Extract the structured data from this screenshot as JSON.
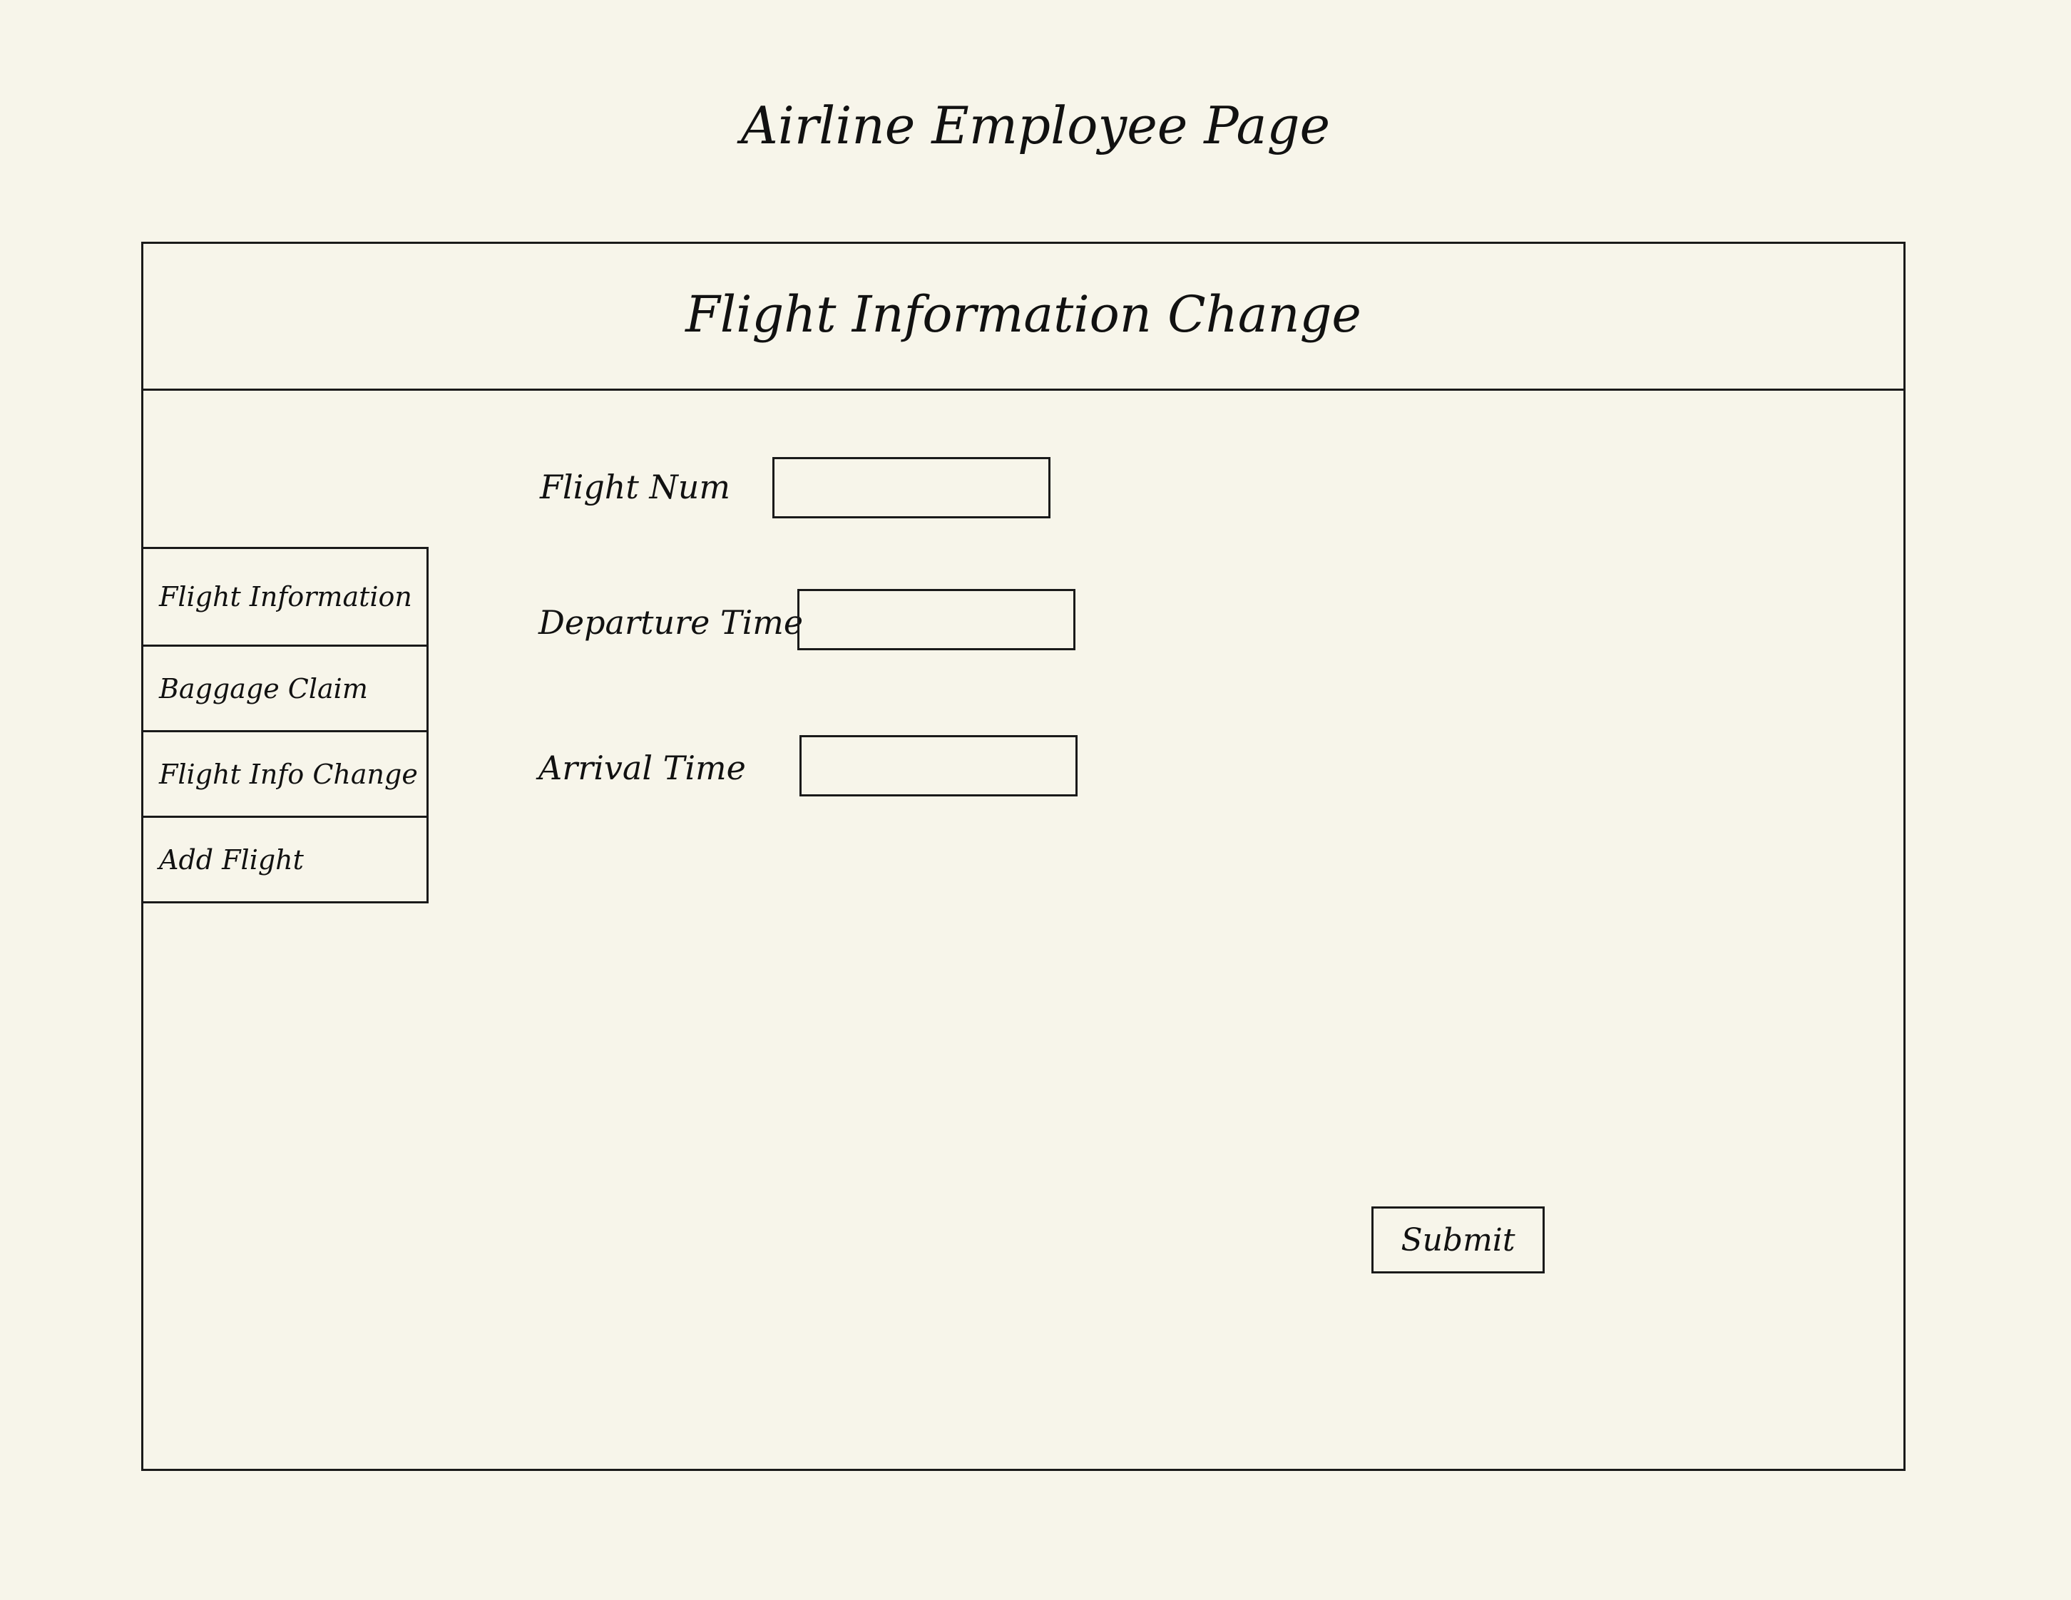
{
  "page": {
    "title": "Airline Employee Page"
  },
  "panel": {
    "title": "Flight Information Change"
  },
  "sidebar": {
    "items": [
      {
        "label": "Flight Information"
      },
      {
        "label": "Baggage Claim"
      },
      {
        "label": "Flight Info Change"
      },
      {
        "label": "Add Flight"
      }
    ]
  },
  "form": {
    "flight_num": {
      "label": "Flight Num",
      "value": ""
    },
    "departure_time": {
      "label": "Departure Time",
      "value": ""
    },
    "arrival_time": {
      "label": "Arrival Time",
      "value": ""
    },
    "submit_label": "Submit"
  },
  "colors": {
    "background": "#f7f5ea",
    "ink": "#111111"
  }
}
